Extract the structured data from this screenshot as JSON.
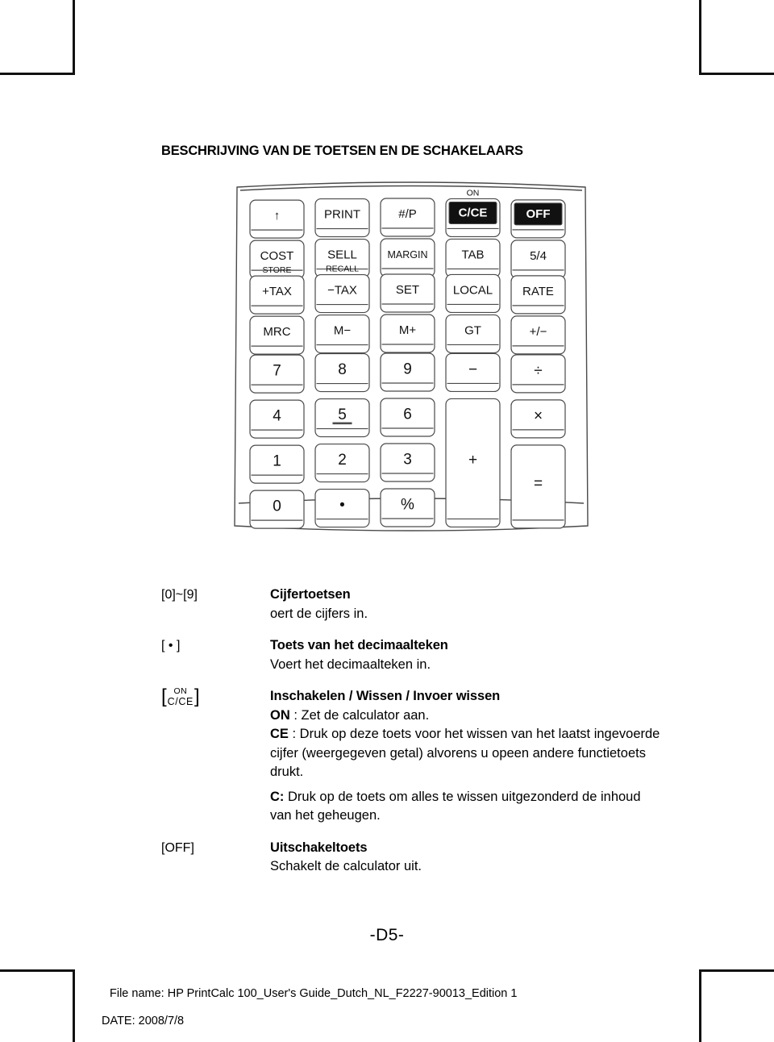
{
  "page": {
    "title": "BESCHRIJVING VAN DE TOETSEN EN DE SCHAKELAARS",
    "page_number": "-D5-"
  },
  "keypad": {
    "rows": [
      {
        "keys": [
          {
            "label": "↑",
            "sub": "",
            "inverted": false
          },
          {
            "label": "PRINT",
            "sub": "",
            "inverted": false
          },
          {
            "label": "#/P",
            "sub": "",
            "inverted": false
          },
          {
            "label": "C/CE",
            "sub": "ON",
            "inverted": true
          },
          {
            "label": "OFF",
            "sub": "",
            "inverted": true
          }
        ]
      },
      {
        "keys": [
          {
            "label": "COST",
            "sub": "",
            "inverted": false
          },
          {
            "label": "SELL",
            "sub": "",
            "inverted": false
          },
          {
            "label": "MARGIN",
            "sub": "",
            "inverted": false
          },
          {
            "label": "TAB",
            "sub": "",
            "inverted": false
          },
          {
            "label": "5/4",
            "sub": "",
            "inverted": false
          }
        ]
      },
      {
        "keys": [
          {
            "label": "+TAX",
            "sub": "STORE",
            "inverted": false
          },
          {
            "label": "−TAX",
            "sub": "RECALL",
            "inverted": false
          },
          {
            "label": "SET",
            "sub": "",
            "inverted": false
          },
          {
            "label": "LOCAL",
            "sub": "",
            "inverted": false
          },
          {
            "label": "RATE",
            "sub": "",
            "inverted": false
          }
        ]
      },
      {
        "keys": [
          {
            "label": "MRC",
            "sub": "",
            "inverted": false
          },
          {
            "label": "M−",
            "sub": "",
            "inverted": false
          },
          {
            "label": "M+",
            "sub": "",
            "inverted": false
          },
          {
            "label": "GT",
            "sub": "",
            "inverted": false
          },
          {
            "label": "+/−",
            "sub": "",
            "inverted": false
          }
        ]
      },
      {
        "keys": [
          {
            "label": "7",
            "sub": "",
            "inverted": false
          },
          {
            "label": "8",
            "sub": "",
            "inverted": false
          },
          {
            "label": "9",
            "sub": "",
            "inverted": false
          },
          {
            "label": "−",
            "sub": "",
            "inverted": false
          },
          {
            "label": "÷",
            "sub": "",
            "inverted": false
          }
        ]
      },
      {
        "keys": [
          {
            "label": "4",
            "sub": "",
            "inverted": false
          },
          {
            "label": "5",
            "sub": "",
            "inverted": false
          },
          {
            "label": "6",
            "sub": "",
            "inverted": false
          },
          {
            "label": "+",
            "sub": "",
            "inverted": false
          },
          {
            "label": "×",
            "sub": "",
            "inverted": false
          }
        ]
      },
      {
        "keys": [
          {
            "label": "1",
            "sub": "",
            "inverted": false
          },
          {
            "label": "2",
            "sub": "",
            "inverted": false
          },
          {
            "label": "3",
            "sub": "",
            "inverted": false
          },
          {
            "label": "",
            "sub": "",
            "inverted": false
          },
          {
            "label": "=",
            "sub": "",
            "inverted": false
          }
        ]
      },
      {
        "keys": [
          {
            "label": "0",
            "sub": "",
            "inverted": false
          },
          {
            "label": "•",
            "sub": "",
            "inverted": false
          },
          {
            "label": "%",
            "sub": "",
            "inverted": false
          },
          {
            "label": "",
            "sub": "",
            "inverted": false
          },
          {
            "label": "",
            "sub": "",
            "inverted": false
          }
        ]
      }
    ]
  },
  "descriptions": [
    {
      "key_type": "plain",
      "key": "[0]~[9]",
      "heading": "Cijfertoetsen",
      "lines": [
        {
          "lead": "",
          "text": "oert de cijfers in."
        }
      ]
    },
    {
      "key_type": "plain",
      "key": "[ • ]",
      "heading": "Toets van het decimaalteken",
      "lines": [
        {
          "lead": "",
          "text": "Voert het decimaalteken in."
        }
      ]
    },
    {
      "key_type": "stacked",
      "key_top": "ON",
      "key_bottom": "C/CE",
      "heading": "Inschakelen / Wissen / Invoer wissen",
      "lines": [
        {
          "lead": "ON",
          "text": " : Zet de calculator aan."
        },
        {
          "lead": "CE",
          "text": " : Druk op deze toets voor het wissen van het laatst ingevoerde cijfer (weergegeven getal) alvorens u opeen andere functietoets drukt."
        },
        {
          "lead": "C:",
          "text": " Druk op de toets om alles te wissen uitgezonderd de inhoud van het geheugen."
        }
      ]
    },
    {
      "key_type": "plain",
      "key": "[OFF]",
      "heading": "Uitschakeltoets",
      "lines": [
        {
          "lead": "",
          "text": "Schakelt de calculator uit."
        }
      ]
    }
  ],
  "footer": {
    "file_name": "File name: HP PrintCalc 100_User's Guide_Dutch_NL_F2227-90013_Edition 1",
    "date": "DATE: 2008/7/8"
  },
  "colors": {
    "ink": "#000000",
    "outline": "#4a4a4a",
    "paper": "#ffffff"
  }
}
